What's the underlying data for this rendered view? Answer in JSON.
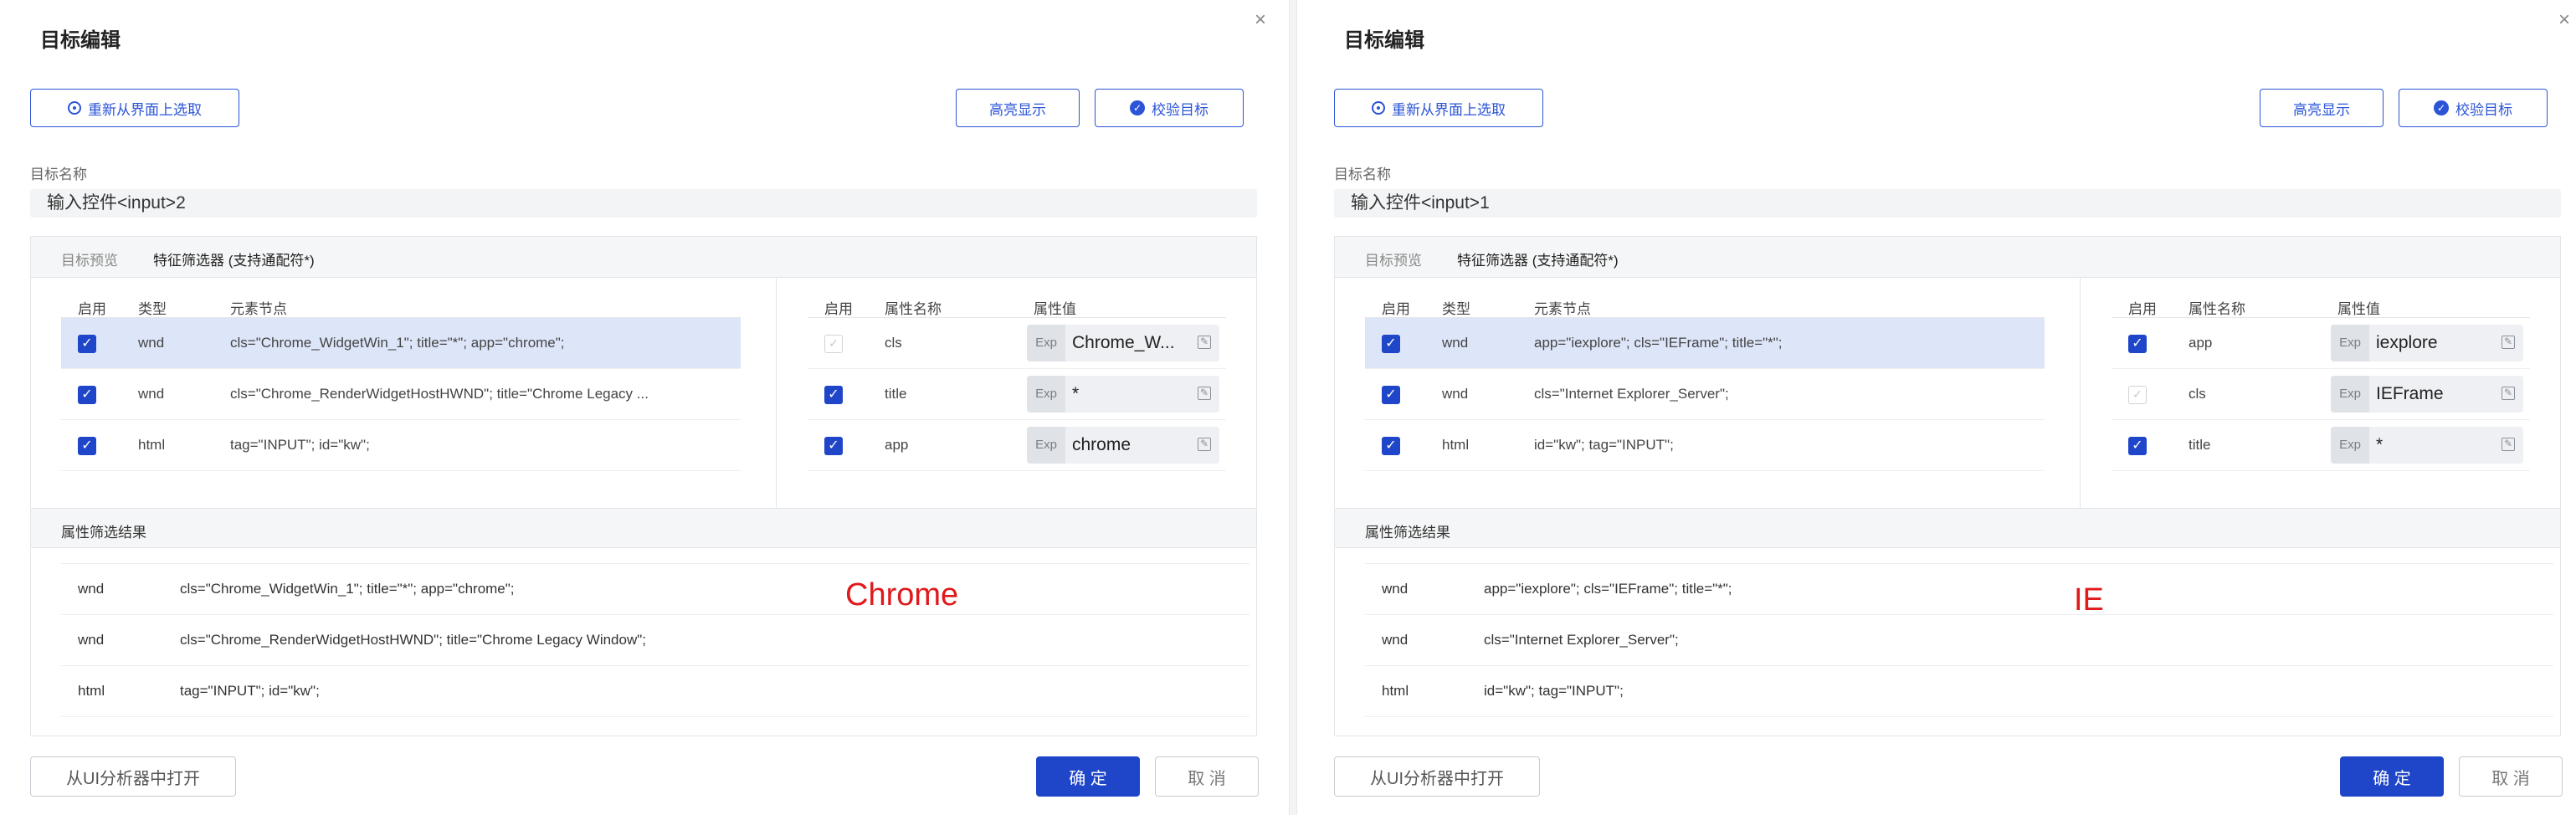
{
  "panels": [
    {
      "title": "目标编辑",
      "reselect_label": "重新从界面上选取",
      "highlight_label": "高亮显示",
      "verify_label": "校验目标",
      "name_label": "目标名称",
      "name_value": "输入控件<input>2",
      "tabs": [
        "目标预览",
        "特征筛选器 (支持通配符*)"
      ],
      "node_columns": [
        "启用",
        "类型",
        "元素节点"
      ],
      "nodes": [
        {
          "type": "wnd",
          "node": "cls=\"Chrome_WidgetWin_1\"; title=\"*\"; app=\"chrome\";"
        },
        {
          "type": "wnd",
          "node": "cls=\"Chrome_RenderWidgetHostHWND\"; title=\"Chrome Legacy ..."
        },
        {
          "type": "html",
          "node": "tag=\"INPUT\"; id=\"kw\";"
        }
      ],
      "attr_columns": [
        "启用",
        "属性名称",
        "属性值"
      ],
      "attrs": [
        {
          "name": "cls",
          "exp": "Exp",
          "value": "Chrome_W...",
          "enabled": false
        },
        {
          "name": "title",
          "exp": "Exp",
          "value": "*",
          "enabled": true
        },
        {
          "name": "app",
          "exp": "Exp",
          "value": "chrome",
          "enabled": true
        }
      ],
      "results_title": "属性筛选结果",
      "results": [
        {
          "type": "wnd",
          "value": "cls=\"Chrome_WidgetWin_1\"; title=\"*\"; app=\"chrome\";"
        },
        {
          "type": "wnd",
          "value": "cls=\"Chrome_RenderWidgetHostHWND\"; title=\"Chrome Legacy Window\";"
        },
        {
          "type": "html",
          "value": "tag=\"INPUT\"; id=\"kw\";"
        }
      ],
      "annotation": "Chrome",
      "uia_label": "从UI分析器中打开",
      "ok_label": "确 定",
      "cancel_label": "取 消"
    },
    {
      "title": "目标编辑",
      "reselect_label": "重新从界面上选取",
      "highlight_label": "高亮显示",
      "verify_label": "校验目标",
      "name_label": "目标名称",
      "name_value": "输入控件<input>1",
      "tabs": [
        "目标预览",
        "特征筛选器 (支持通配符*)"
      ],
      "node_columns": [
        "启用",
        "类型",
        "元素节点"
      ],
      "nodes": [
        {
          "type": "wnd",
          "node": "app=\"iexplore\"; cls=\"IEFrame\"; title=\"*\";"
        },
        {
          "type": "wnd",
          "node": "cls=\"Internet Explorer_Server\";"
        },
        {
          "type": "html",
          "node": "id=\"kw\"; tag=\"INPUT\";"
        }
      ],
      "attr_columns": [
        "启用",
        "属性名称",
        "属性值"
      ],
      "attrs": [
        {
          "name": "app",
          "exp": "Exp",
          "value": "iexplore",
          "enabled": true
        },
        {
          "name": "cls",
          "exp": "Exp",
          "value": "IEFrame",
          "enabled": false
        },
        {
          "name": "title",
          "exp": "Exp",
          "value": "*",
          "enabled": true
        }
      ],
      "results_title": "属性筛选结果",
      "results": [
        {
          "type": "wnd",
          "value": "app=\"iexplore\"; cls=\"IEFrame\"; title=\"*\";"
        },
        {
          "type": "wnd",
          "value": "cls=\"Internet Explorer_Server\";"
        },
        {
          "type": "html",
          "value": "id=\"kw\"; tag=\"INPUT\";"
        }
      ],
      "annotation": "IE",
      "uia_label": "从UI分析器中打开",
      "ok_label": "确 定",
      "cancel_label": "取 消"
    }
  ],
  "icons": {
    "close": "close-icon",
    "reselect": "crosshair-icon",
    "verify": "check-circle-icon",
    "checkbox": "checkbox-checked-icon",
    "edit": "edit-icon"
  },
  "colors": {
    "primary": "#1f45c9",
    "selected_row": "#dde5f8",
    "annotation": "#e0191b"
  }
}
